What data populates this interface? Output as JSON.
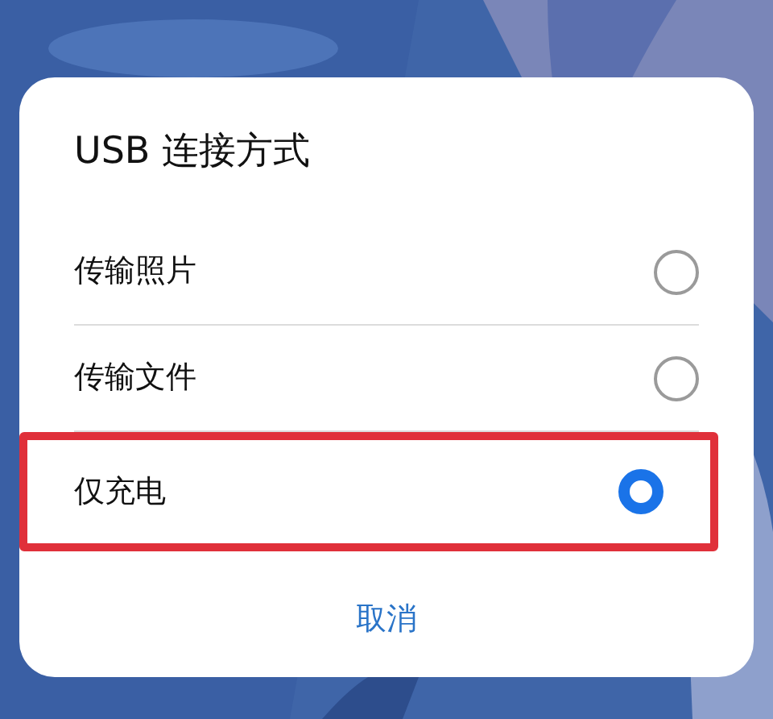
{
  "dialog": {
    "title": "USB 连接方式",
    "options": [
      {
        "label": "传输照片",
        "selected": false,
        "highlighted": false
      },
      {
        "label": "传输文件",
        "selected": false,
        "highlighted": false
      },
      {
        "label": "仅充电",
        "selected": true,
        "highlighted": true
      }
    ],
    "buttons": [
      "取消"
    ]
  }
}
